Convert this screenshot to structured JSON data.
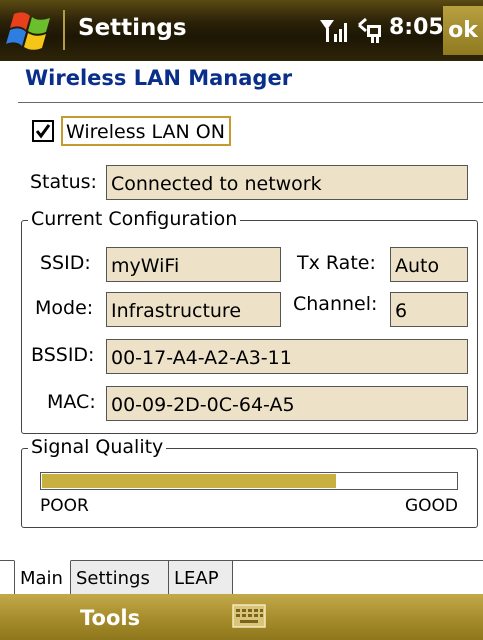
{
  "titlebar": {
    "app_title": "Settings",
    "time": "8:05",
    "ok_label": "ok"
  },
  "page": {
    "title": "Wireless LAN Manager"
  },
  "wireless": {
    "checkbox_label": "Wireless LAN ON",
    "checked": true,
    "status_label": "Status:",
    "status_value": "Connected to network"
  },
  "config": {
    "group_label": "Current Configuration",
    "ssid_label": "SSID:",
    "ssid_value": "myWiFi",
    "txrate_label": "Tx Rate:",
    "txrate_value": "Auto",
    "mode_label": "Mode:",
    "mode_value": "Infrastructure",
    "channel_label": "Channel:",
    "channel_value": "6",
    "bssid_label": "BSSID:",
    "bssid_value": "00-17-A4-A2-A3-11",
    "mac_label": "MAC:",
    "mac_value": "00-09-2D-0C-64-A5"
  },
  "signal": {
    "group_label": "Signal Quality",
    "level_fraction": 0.71,
    "min_label": "POOR",
    "max_label": "GOOD",
    "fill_color": "#c7b040"
  },
  "tabs": [
    {
      "label": "Main",
      "active": true
    },
    {
      "label": "Settings",
      "active": false
    },
    {
      "label": "LEAP",
      "active": false
    }
  ],
  "menubar": {
    "left_label": "Tools",
    "keyboard_icon": "keyboard-icon"
  },
  "colors": {
    "title_blue": "#0a2f8a",
    "field_bg": "#ede2c8",
    "accent_gold": "#c69a2c"
  }
}
